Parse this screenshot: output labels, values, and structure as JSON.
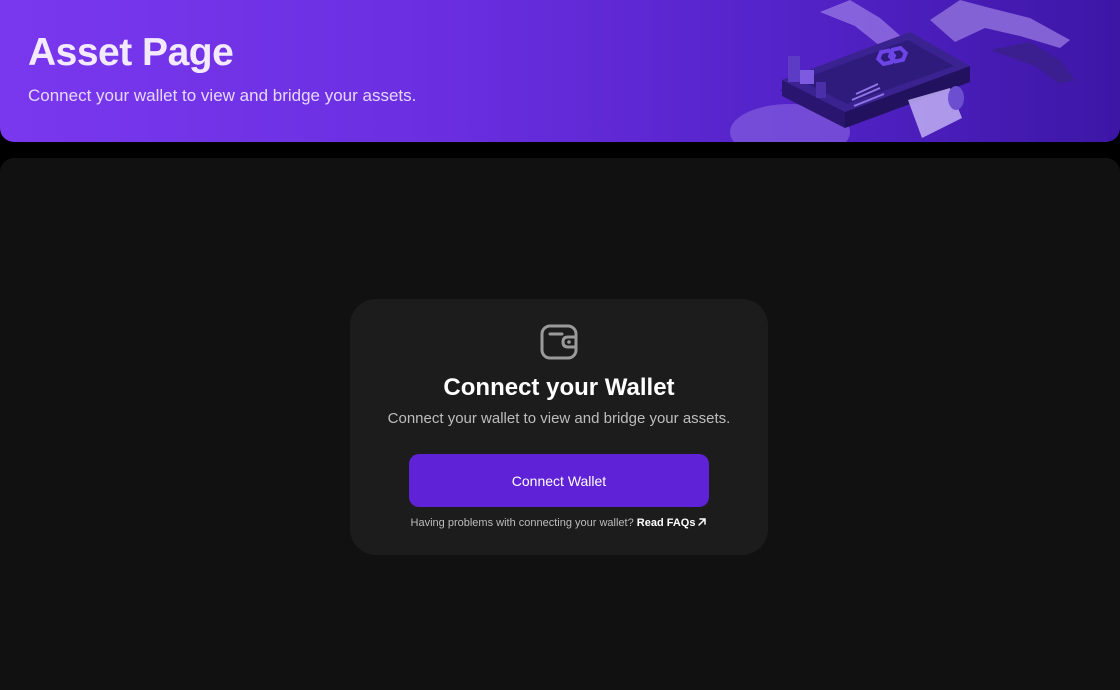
{
  "banner": {
    "title": "Asset Page",
    "subtitle": "Connect your wallet to view and bridge your assets.",
    "illustration_icon": "polygon-logo-device-illustration"
  },
  "connect_card": {
    "icon": "wallet-icon",
    "title": "Connect your Wallet",
    "subtitle": "Connect your wallet to view and bridge your assets.",
    "button_label": "Connect Wallet",
    "help_text": "Having problems with connecting your wallet?",
    "faq_link_label": "Read FAQs",
    "faq_link_icon": "arrow-up-right-icon"
  },
  "colors": {
    "banner_gradient_start": "#7a38ee",
    "banner_gradient_end": "#3d16a6",
    "background": "#111111",
    "card": "#1c1c1c",
    "button": "#5f22d6"
  }
}
